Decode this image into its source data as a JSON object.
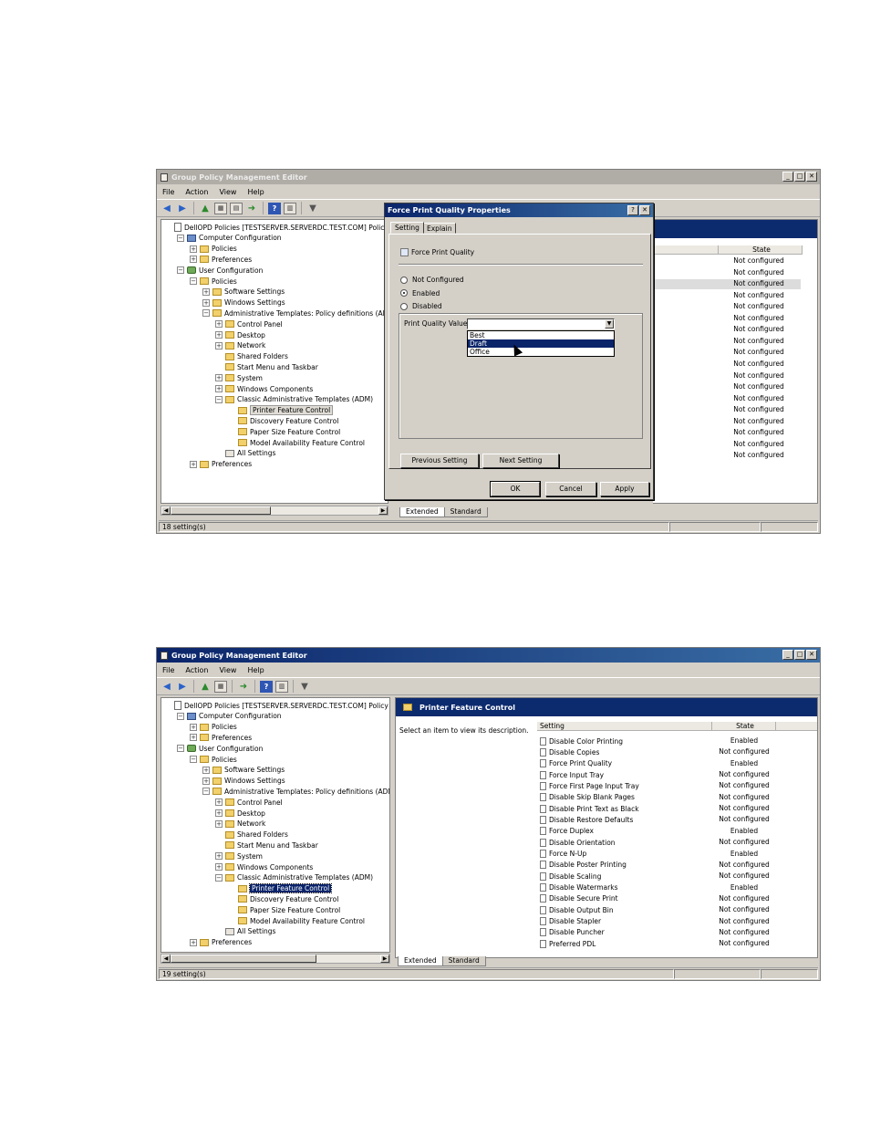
{
  "screen1": {
    "title": "Group Policy Management Editor",
    "menu": [
      "File",
      "Action",
      "View",
      "Help"
    ],
    "tree": [
      {
        "label": "DellOPD Policies [TESTSERVER.SERVERDC.TEST.COM] Policy",
        "icon": "doc",
        "indent": 0,
        "pm": "",
        "style": ""
      },
      {
        "label": "Computer Configuration",
        "icon": "pc",
        "indent": 1,
        "pm": "−",
        "style": ""
      },
      {
        "label": "Policies",
        "icon": "folder",
        "indent": 2,
        "pm": "+",
        "style": ""
      },
      {
        "label": "Preferences",
        "icon": "folder",
        "indent": 2,
        "pm": "+",
        "style": ""
      },
      {
        "label": "User Configuration",
        "icon": "user",
        "indent": 1,
        "pm": "−",
        "style": ""
      },
      {
        "label": "Policies",
        "icon": "folder",
        "indent": 2,
        "pm": "−",
        "style": ""
      },
      {
        "label": "Software Settings",
        "icon": "folder",
        "indent": 3,
        "pm": "+",
        "style": ""
      },
      {
        "label": "Windows Settings",
        "icon": "folder",
        "indent": 3,
        "pm": "+",
        "style": ""
      },
      {
        "label": "Administrative Templates: Policy definitions (ADMX fil",
        "icon": "folder",
        "indent": 3,
        "pm": "−",
        "style": ""
      },
      {
        "label": "Control Panel",
        "icon": "folder",
        "indent": 4,
        "pm": "+",
        "style": ""
      },
      {
        "label": "Desktop",
        "icon": "folder",
        "indent": 4,
        "pm": "+",
        "style": ""
      },
      {
        "label": "Network",
        "icon": "folder",
        "indent": 4,
        "pm": "+",
        "style": ""
      },
      {
        "label": "Shared Folders",
        "icon": "folder",
        "indent": 4,
        "pm": "",
        "style": ""
      },
      {
        "label": "Start Menu and Taskbar",
        "icon": "folder",
        "indent": 4,
        "pm": "",
        "style": ""
      },
      {
        "label": "System",
        "icon": "folder",
        "indent": 4,
        "pm": "+",
        "style": ""
      },
      {
        "label": "Windows Components",
        "icon": "folder",
        "indent": 4,
        "pm": "+",
        "style": ""
      },
      {
        "label": "Classic Administrative Templates (ADM)",
        "icon": "folder",
        "indent": 4,
        "pm": "−",
        "style": ""
      },
      {
        "label": "Printer Feature Control",
        "icon": "folder",
        "indent": 5,
        "pm": "",
        "style": "hl"
      },
      {
        "label": "Discovery Feature Control",
        "icon": "folder",
        "indent": 5,
        "pm": "",
        "style": ""
      },
      {
        "label": "Paper Size Feature Control",
        "icon": "folder",
        "indent": 5,
        "pm": "",
        "style": ""
      },
      {
        "label": "Model Availability Feature Control",
        "icon": "folder",
        "indent": 5,
        "pm": "",
        "style": ""
      },
      {
        "label": "All Settings",
        "icon": "allset",
        "indent": 4,
        "pm": "",
        "style": ""
      },
      {
        "label": "Preferences",
        "icon": "folder",
        "indent": 2,
        "pm": "+",
        "style": ""
      }
    ],
    "state_header": "State",
    "states": [
      "Not configured",
      "Not configured",
      "Not configured",
      "Not configured",
      "Not configured",
      "Not configured",
      "Not configured",
      "Not configured",
      "Not configured",
      "Not configured",
      "Not configured",
      "Not configured",
      "Not configured",
      "Not configured",
      "Not configured",
      "Not configured",
      "Not configured",
      "Not configured"
    ],
    "tabs": [
      "Extended",
      "Standard"
    ],
    "status": "18 setting(s)",
    "dialog": {
      "title": "Force Print Quality Properties",
      "tabs": [
        "Setting",
        "Explain"
      ],
      "policy_name": "Force Print Quality",
      "radios": [
        {
          "label": "Not Configured",
          "checked": false
        },
        {
          "label": "Enabled",
          "checked": true
        },
        {
          "label": "Disabled",
          "checked": false
        }
      ],
      "field_label": "Print Quality Value",
      "combo_value": "",
      "options": [
        {
          "label": "Best",
          "selected": false
        },
        {
          "label": "Draft",
          "selected": true
        },
        {
          "label": "Office",
          "selected": false
        }
      ],
      "prev_button": "Previous Setting",
      "next_button": "Next Setting",
      "ok": "OK",
      "cancel": "Cancel",
      "apply": "Apply"
    }
  },
  "screen2": {
    "title": "Group Policy Management Editor",
    "menu": [
      "File",
      "Action",
      "View",
      "Help"
    ],
    "tree": [
      {
        "label": "DellOPD Policies [TESTSERVER.SERVERDC.TEST.COM] Policy",
        "icon": "doc",
        "indent": 0,
        "pm": "",
        "style": ""
      },
      {
        "label": "Computer Configuration",
        "icon": "pc",
        "indent": 1,
        "pm": "−",
        "style": ""
      },
      {
        "label": "Policies",
        "icon": "folder",
        "indent": 2,
        "pm": "+",
        "style": ""
      },
      {
        "label": "Preferences",
        "icon": "folder",
        "indent": 2,
        "pm": "+",
        "style": ""
      },
      {
        "label": "User Configuration",
        "icon": "user",
        "indent": 1,
        "pm": "−",
        "style": ""
      },
      {
        "label": "Policies",
        "icon": "folder",
        "indent": 2,
        "pm": "−",
        "style": ""
      },
      {
        "label": "Software Settings",
        "icon": "folder",
        "indent": 3,
        "pm": "+",
        "style": ""
      },
      {
        "label": "Windows Settings",
        "icon": "folder",
        "indent": 3,
        "pm": "+",
        "style": ""
      },
      {
        "label": "Administrative Templates: Policy definitions (ADMX files)",
        "icon": "folder",
        "indent": 3,
        "pm": "−",
        "style": ""
      },
      {
        "label": "Control Panel",
        "icon": "folder",
        "indent": 4,
        "pm": "+",
        "style": ""
      },
      {
        "label": "Desktop",
        "icon": "folder",
        "indent": 4,
        "pm": "+",
        "style": ""
      },
      {
        "label": "Network",
        "icon": "folder",
        "indent": 4,
        "pm": "+",
        "style": ""
      },
      {
        "label": "Shared Folders",
        "icon": "folder",
        "indent": 4,
        "pm": "",
        "style": ""
      },
      {
        "label": "Start Menu and Taskbar",
        "icon": "folder",
        "indent": 4,
        "pm": "",
        "style": ""
      },
      {
        "label": "System",
        "icon": "folder",
        "indent": 4,
        "pm": "+",
        "style": ""
      },
      {
        "label": "Windows Components",
        "icon": "folder",
        "indent": 4,
        "pm": "+",
        "style": ""
      },
      {
        "label": "Classic Administrative Templates (ADM)",
        "icon": "folder",
        "indent": 4,
        "pm": "−",
        "style": ""
      },
      {
        "label": "Printer Feature Control",
        "icon": "folder",
        "indent": 5,
        "pm": "",
        "style": "sel"
      },
      {
        "label": "Discovery Feature Control",
        "icon": "folder",
        "indent": 5,
        "pm": "",
        "style": ""
      },
      {
        "label": "Paper Size Feature Control",
        "icon": "folder",
        "indent": 5,
        "pm": "",
        "style": ""
      },
      {
        "label": "Model Availability Feature Control",
        "icon": "folder",
        "indent": 5,
        "pm": "",
        "style": ""
      },
      {
        "label": "All Settings",
        "icon": "allset",
        "indent": 4,
        "pm": "",
        "style": ""
      },
      {
        "label": "Preferences",
        "icon": "folder",
        "indent": 2,
        "pm": "+",
        "style": ""
      }
    ],
    "banner_title": "Printer Feature Control",
    "description": "Select an item to view its description.",
    "setting_header": "Setting",
    "state_header": "State",
    "policies": [
      {
        "name": "Disable Color Printing",
        "state": "Enabled"
      },
      {
        "name": "Disable Copies",
        "state": "Not configured"
      },
      {
        "name": "Force Print Quality",
        "state": "Enabled"
      },
      {
        "name": "Force Input Tray",
        "state": "Not configured"
      },
      {
        "name": "Force First Page Input Tray",
        "state": "Not configured"
      },
      {
        "name": "Disable Skip Blank Pages",
        "state": "Not configured"
      },
      {
        "name": "Disable Print Text as Black",
        "state": "Not configured"
      },
      {
        "name": "Disable Restore Defaults",
        "state": "Not configured"
      },
      {
        "name": "Force Duplex",
        "state": "Enabled"
      },
      {
        "name": "Disable Orientation",
        "state": "Not configured"
      },
      {
        "name": "Force N-Up",
        "state": "Enabled"
      },
      {
        "name": "Disable Poster Printing",
        "state": "Not configured"
      },
      {
        "name": "Disable Scaling",
        "state": "Not configured"
      },
      {
        "name": "Disable Watermarks",
        "state": "Enabled"
      },
      {
        "name": "Disable Secure Print",
        "state": "Not configured"
      },
      {
        "name": "Disable Output Bin",
        "state": "Not configured"
      },
      {
        "name": "Disable Stapler",
        "state": "Not configured"
      },
      {
        "name": "Disable Puncher",
        "state": "Not configured"
      },
      {
        "name": "Preferred PDL",
        "state": "Not configured"
      }
    ],
    "tabs": [
      "Extended",
      "Standard"
    ],
    "status": "19 setting(s)"
  }
}
